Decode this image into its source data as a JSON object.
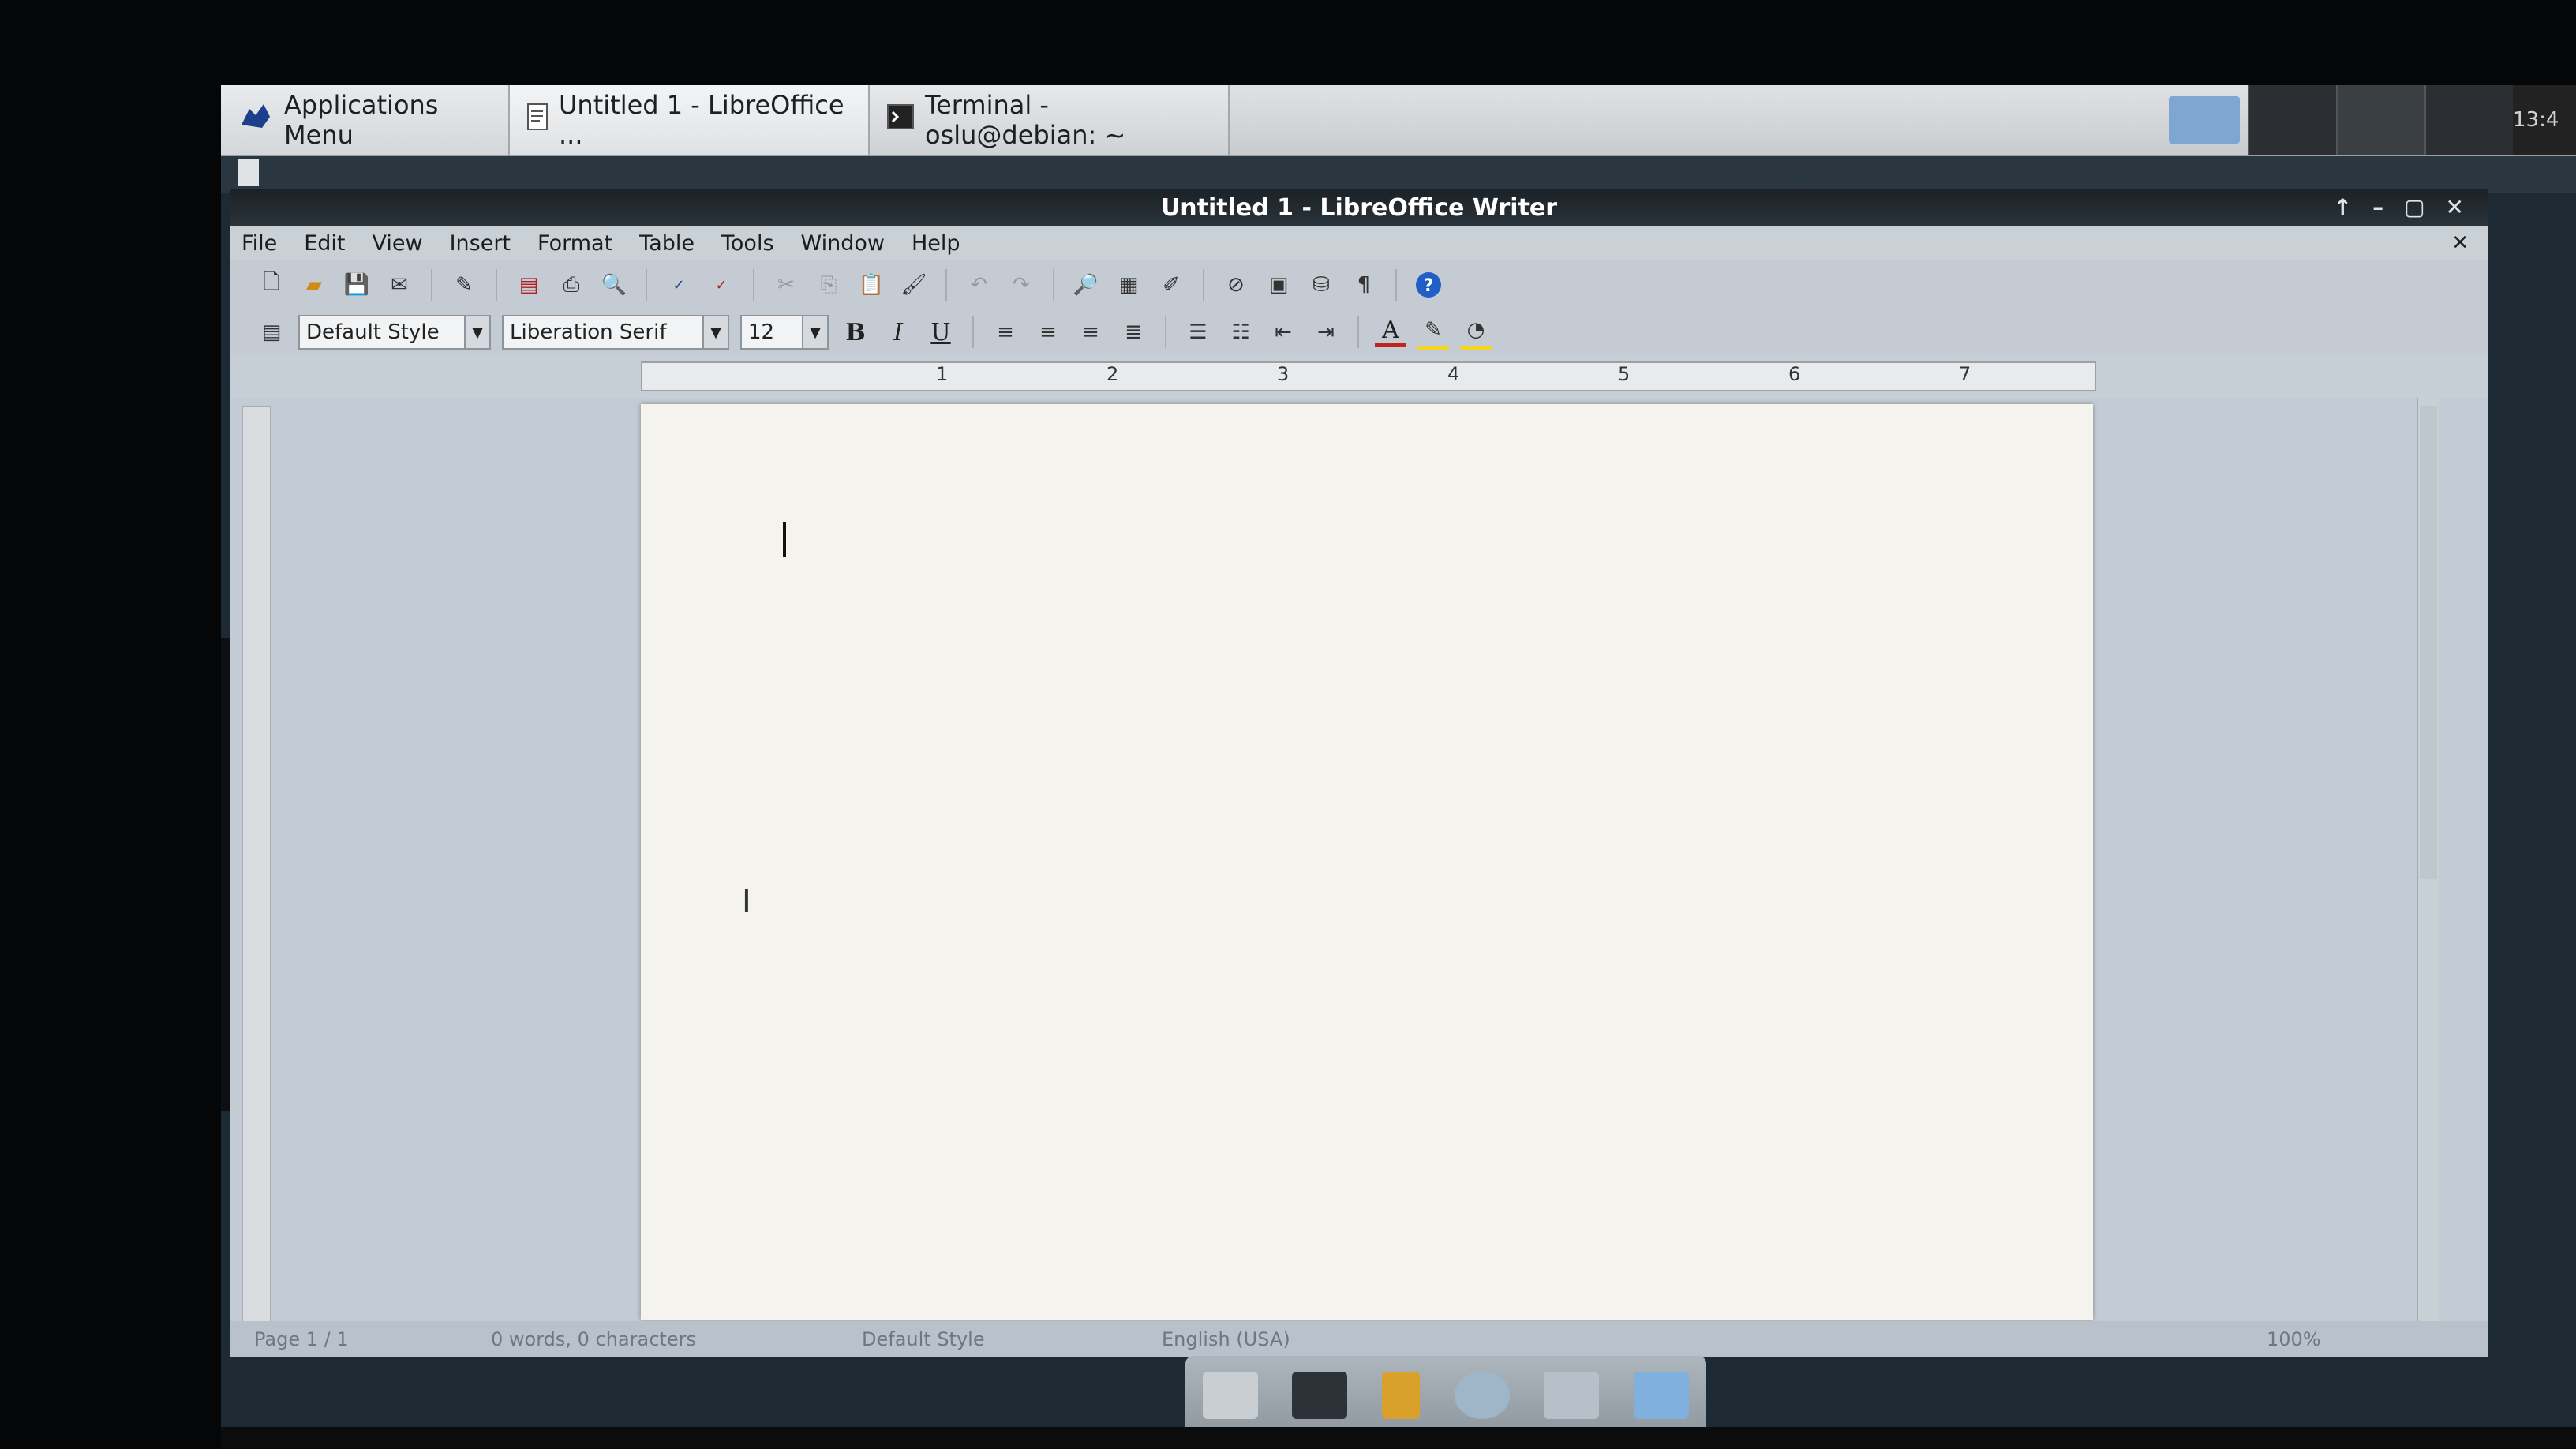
{
  "taskbar": {
    "apps_menu": "Applications Menu",
    "writer_task": "Untitled 1 - LibreOffice ...",
    "terminal_task": "Terminal - oslu@debian: ~",
    "clock": "13:4"
  },
  "window": {
    "title": "Untitled 1 - LibreOffice Writer"
  },
  "menu": [
    "File",
    "Edit",
    "View",
    "Insert",
    "Format",
    "Table",
    "Tools",
    "Window",
    "Help"
  ],
  "formatting": {
    "paragraph_style": "Default Style",
    "font_name": "Liberation Serif",
    "font_size": "12",
    "bold": "B",
    "italic": "I",
    "underline": "U",
    "font_color": "A"
  },
  "ruler": {
    "labels": [
      "1",
      "2",
      "3",
      "4",
      "5",
      "6",
      "7"
    ]
  },
  "statusbar": {
    "page": "Page 1 / 1",
    "words": "0 words, 0 characters",
    "style": "Default Style",
    "language": "English (USA)",
    "zoom": "100%"
  },
  "colors": {
    "titlebar": "#1b2227",
    "help_icon": "#1f5fc6",
    "font_color_bar": "#c0241c",
    "highlight": "#f2d51e"
  }
}
